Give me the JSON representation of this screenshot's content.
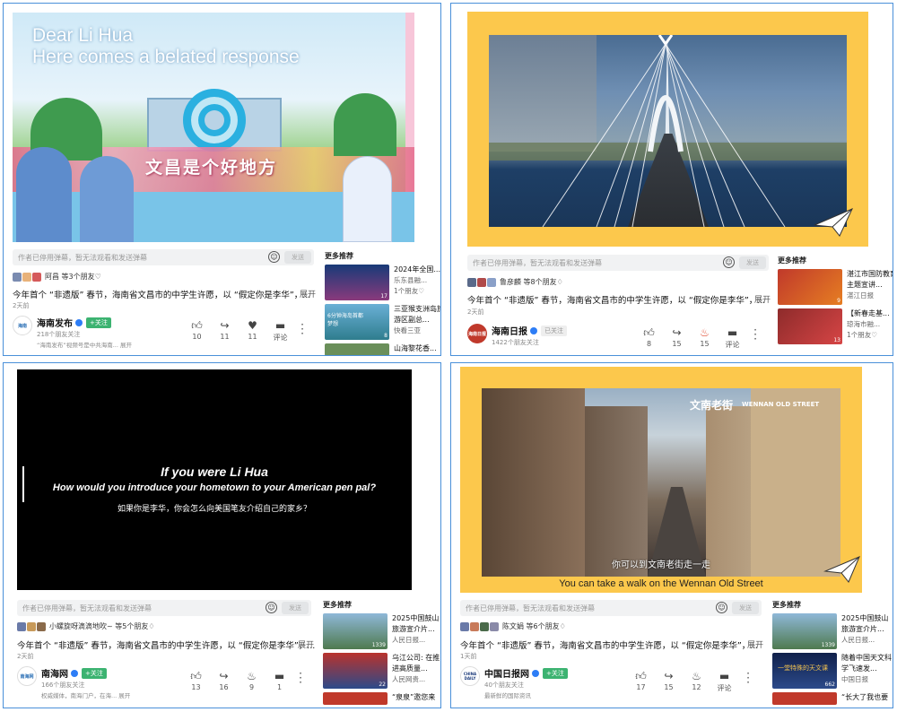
{
  "colors": {
    "accent": "#4a90d9",
    "follow": "#3cb371",
    "verified": "#2d7df6",
    "frame_yellow": "#fcc84c"
  },
  "common": {
    "comment_placeholder": "作者已停用弹幕，暂无法观看和发送弹幕",
    "send": "发送",
    "recs_title": "更多推荐",
    "expand": "展开",
    "desc": "今年首个 “非遗版” 春节，海南省文昌市的中学生许愿，以 “假定你是李华”，..."
  },
  "p1": {
    "video_title_line1": "Dear Li Hua",
    "video_title_line2": "Here comes a belated response",
    "banner_text": "文昌是个好地方",
    "friends": "阿昌 等3个朋友♡",
    "time": "2天前",
    "account": {
      "name": "海南发布",
      "follow": "+关注",
      "sub": "218个朋友关注",
      "sub2": "“海南发布”视频号是中共海南... 展开"
    },
    "actions": [
      {
        "icon": "thumb-up-icon",
        "val": "10"
      },
      {
        "icon": "share-icon",
        "val": "11"
      },
      {
        "icon": "heart-icon",
        "val": "11"
      },
      {
        "icon": "comment-icon",
        "val": "评论"
      }
    ],
    "recs": [
      {
        "t": "2024年全国...",
        "s": "乐东县融...",
        "c": "17"
      },
      {
        "t": "三亚猴支洲岛旅游区副总...",
        "s": "快看三亚",
        "c": "8"
      },
      {
        "t": "山海黎花香...",
        "s": "",
        "c": ""
      }
    ],
    "rec_friend": "1个朋友♡",
    "rec_thumb_text": "6分钟海岛首都梦想"
  },
  "p2": {
    "friends": "鲁彦麟 等8个朋友♢",
    "time": "2天前",
    "account": {
      "name": "海南日报",
      "follow": "已关注",
      "sub": "1422个朋友关注",
      "logo": "海南日报"
    },
    "actions": [
      {
        "icon": "thumb-up-icon",
        "val": "8"
      },
      {
        "icon": "share-icon",
        "val": "15"
      },
      {
        "icon": "fire-icon",
        "val": "15"
      },
      {
        "icon": "comment-icon",
        "val": "评论"
      }
    ],
    "recs": [
      {
        "t": "湛江市国防教育主题宣讲...",
        "s": "湛江日报",
        "c": "9"
      },
      {
        "t": "【新春走基...",
        "s": "琼海市融...",
        "c": "13"
      }
    ],
    "rec_friend": "1个朋友♡"
  },
  "p3": {
    "subtitle_en1": "If you were Li Hua",
    "subtitle_en2": "How would you introduce your hometown to your American pen pal?",
    "subtitle_cn": "如果你是李华，你会怎么向美国笔友介绍自己的家乡？",
    "friends": "小螺旋呀滴滴地吹~ 等5个朋友♢",
    "time": "2天前",
    "account": {
      "name": "南海网",
      "follow": "+关注",
      "sub": "166个朋友关注",
      "sub2": "权威媒体，南海门户，在海... 展开",
      "logo": "南海网"
    },
    "actions": [
      {
        "icon": "thumb-up-icon",
        "val": "13"
      },
      {
        "icon": "share-icon",
        "val": "16"
      },
      {
        "icon": "fire-icon",
        "val": "9"
      },
      {
        "icon": "comment-icon",
        "val": "1"
      }
    ],
    "recs": [
      {
        "t": "2025中国鼓山旅游宣介片...",
        "s": "人民日报...",
        "c": "1339"
      },
      {
        "t": "乌江公司: 在推进高质量...",
        "s": "人民网贵...",
        "c": "22"
      },
      {
        "t": "“泉泉”邀您来",
        "s": "",
        "c": ""
      }
    ]
  },
  "p4": {
    "sign_cn": "文南老街",
    "sign_en": "WENNAN OLD STREET",
    "sub_cn": "你可以到文南老街走一走",
    "sub_en": "You can take a walk on the Wennan Old Street",
    "friends": "陈文娟 等6个朋友♢",
    "time": "1天前",
    "account": {
      "name": "中国日报网",
      "follow": "+关注",
      "sub": "40个朋友关注",
      "sub2": "最新鲜的国际资讯",
      "logo": "CHINA DAILY"
    },
    "actions": [
      {
        "icon": "thumb-up-icon",
        "val": "17"
      },
      {
        "icon": "share-icon",
        "val": "15"
      },
      {
        "icon": "fire-icon",
        "val": "12"
      },
      {
        "icon": "comment-icon",
        "val": "评论"
      }
    ],
    "recs": [
      {
        "t": "2025中国鼓山旅游宣介片...",
        "s": "人民日报...",
        "c": "1339"
      },
      {
        "t": "随着中国天文科学飞速发...",
        "s": "中国日报",
        "c": "662"
      },
      {
        "t": "“长大了我也要",
        "s": "",
        "c": ""
      }
    ],
    "rec_thumb_text": "一堂特殊的天文课"
  }
}
